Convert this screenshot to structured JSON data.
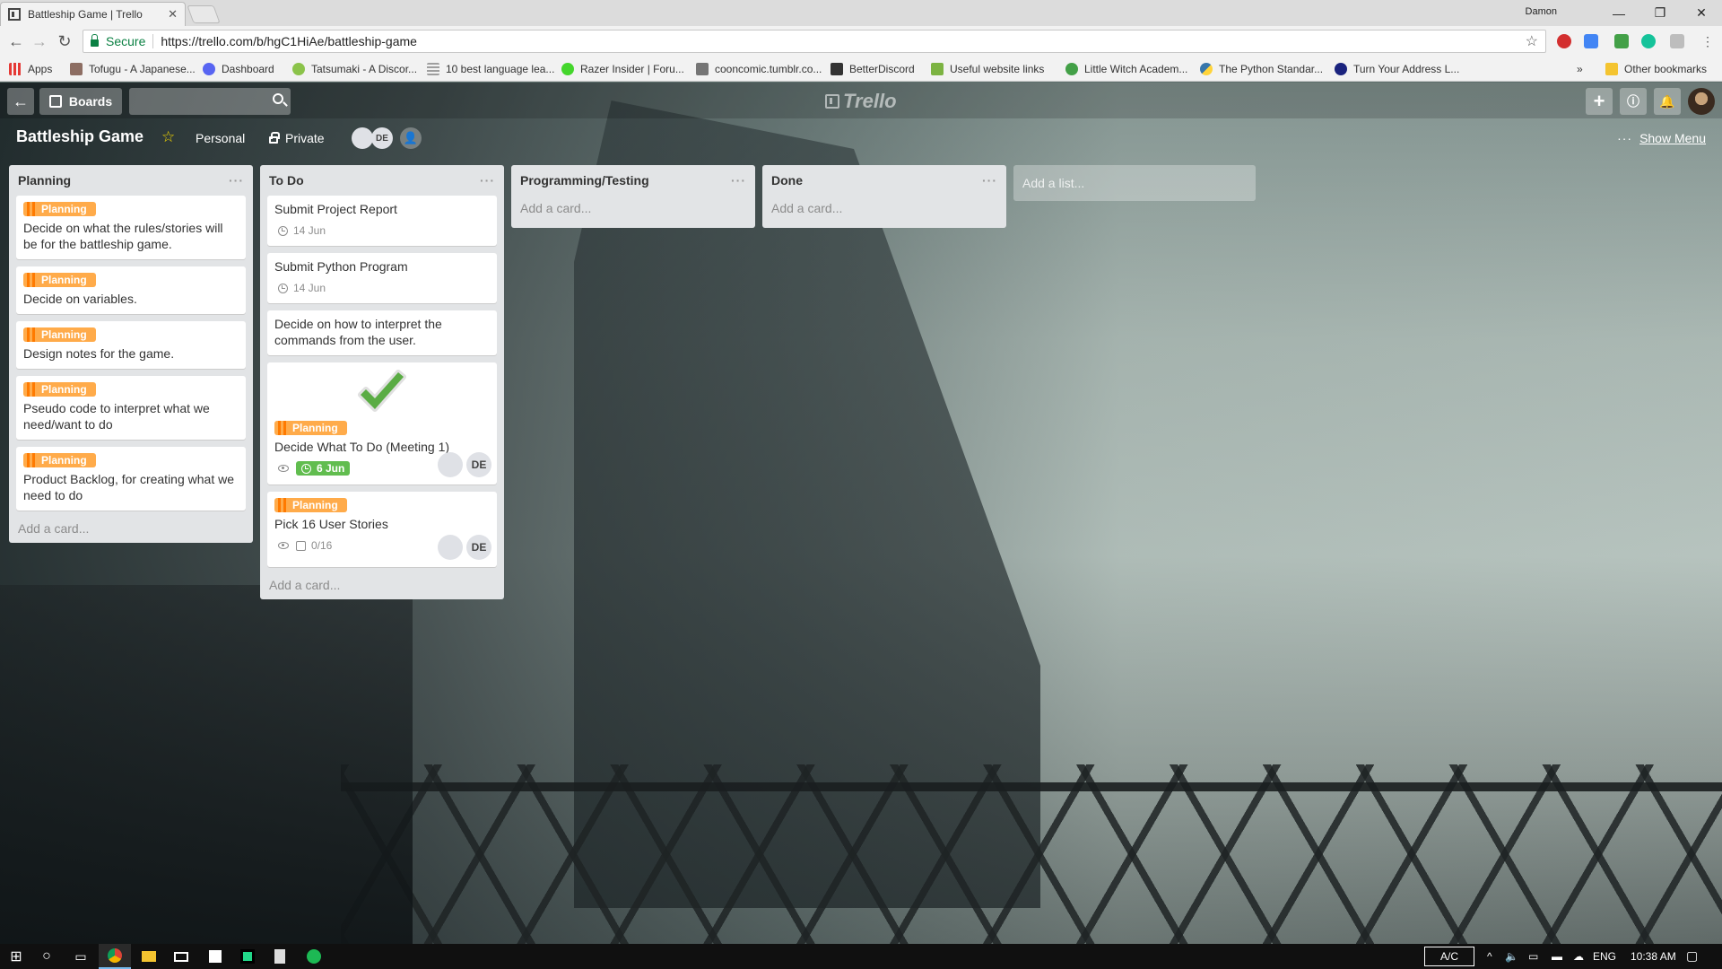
{
  "browser": {
    "tab_title": "Battleship Game | Trello",
    "tab_close": "✕",
    "profile_name": "Damon",
    "secure_label": "Secure",
    "url": "https://trello.com/b/hgC1HiAe/battleship-game",
    "bookmarks": [
      {
        "label": "Apps",
        "icon": "apps-grid-icon",
        "color": "#e53935"
      },
      {
        "label": "Tofugu - A Japanese...",
        "icon": "tofugu-icon",
        "color": "#8d6e63"
      },
      {
        "label": "Dashboard",
        "icon": "discord-icon",
        "color": "#5865f2"
      },
      {
        "label": "Tatsumaki - A Discor...",
        "icon": "tatsumaki-icon",
        "color": "#8bc34a"
      },
      {
        "label": "10 best language lea...",
        "icon": "list-icon",
        "color": "#9e9e9e"
      },
      {
        "label": "Razer Insider | Foru...",
        "icon": "razer-icon",
        "color": "#44d62c"
      },
      {
        "label": "cooncomic.tumblr.co...",
        "icon": "tumblr-icon",
        "color": "#757575"
      },
      {
        "label": "BetterDiscord",
        "icon": "betterdiscord-icon",
        "color": "#333333"
      },
      {
        "label": "Useful website links",
        "icon": "leaf-icon",
        "color": "#7cb342"
      },
      {
        "label": "Little Witch Academ...",
        "icon": "witch-icon",
        "color": "#43a047"
      },
      {
        "label": "The Python Standar...",
        "icon": "python-icon",
        "color": "#3776ab"
      },
      {
        "label": "Turn Your Address L...",
        "icon": "address-icon",
        "color": "#1a237e"
      }
    ],
    "bookmarks_overflow": "»",
    "other_bookmarks": "Other bookmarks"
  },
  "trello": {
    "boards_label": "Boards",
    "logo_text": "Trello",
    "board_title": "Battleship Game",
    "team": "Personal",
    "visibility": "Private",
    "member_initials": "DE",
    "show_menu": "Show Menu",
    "add_list": "Add a list...",
    "add_card": "Add a card...",
    "lists": [
      {
        "title": "Planning",
        "cards": [
          {
            "label": "Planning",
            "title": "Decide on what the rules/stories will be for the battleship game."
          },
          {
            "label": "Planning",
            "title": "Decide on variables."
          },
          {
            "label": "Planning",
            "title": "Design notes for the game."
          },
          {
            "label": "Planning",
            "title": "Pseudo code to interpret what we need/want to do"
          },
          {
            "label": "Planning",
            "title": "Product Backlog, for creating what we need to do"
          }
        ]
      },
      {
        "title": "To Do",
        "cards": [
          {
            "title": "Submit Project Report",
            "due": "14 Jun"
          },
          {
            "title": "Submit Python Program",
            "due": "14 Jun"
          },
          {
            "title": "Decide on how to interpret the commands from the user."
          },
          {
            "label": "Planning",
            "title": "Decide What To Do (Meeting 1)",
            "due": "6 Jun",
            "member": "DE"
          },
          {
            "label": "Planning",
            "title": "Pick 16 User Stories",
            "checklist": "0/16",
            "member": "DE"
          }
        ]
      },
      {
        "title": "Programming/Testing",
        "cards": []
      },
      {
        "title": "Done",
        "cards": []
      }
    ]
  },
  "taskbar": {
    "ac": "A/C",
    "language": "ENG",
    "time": "10:38 AM"
  },
  "colors": {
    "label_orange": "#ffab4a",
    "due_complete": "#61bd4f",
    "list_bg": "#e2e4e6"
  }
}
